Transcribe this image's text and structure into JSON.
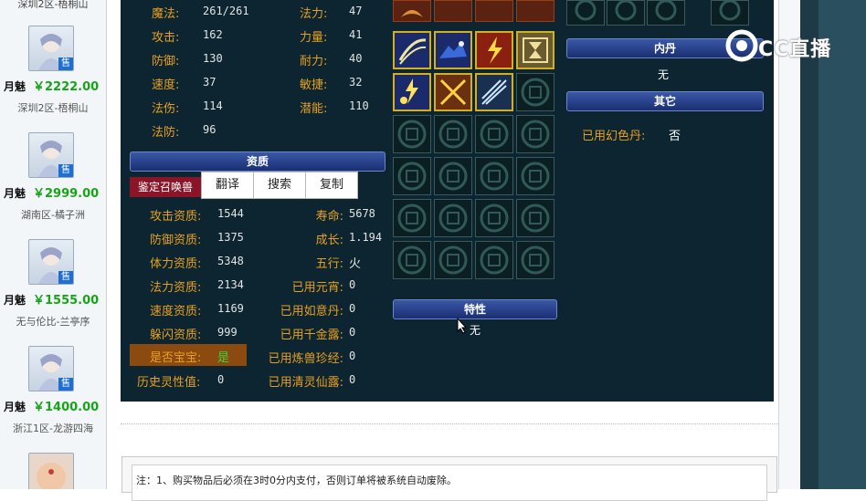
{
  "sidebar": {
    "top_server": "深圳2区-梧桐山",
    "items": [
      {
        "name": "月魅",
        "price": "￥2222.00",
        "server": "深圳2区-梧桐山",
        "badge": "售"
      },
      {
        "name": "月魅",
        "price": "￥2999.00",
        "server": "湖南区-橘子洲",
        "badge": "售"
      },
      {
        "name": "月魅",
        "price": "￥1555.00",
        "server": "无与伦比-兰亭序",
        "badge": "售"
      },
      {
        "name": "月魅",
        "price": "￥1400.00",
        "server": "浙江1区-龙游四海",
        "badge": "售"
      }
    ]
  },
  "stats_left": [
    {
      "label": "魔法:",
      "value": "261/261"
    },
    {
      "label": "攻击:",
      "value": "162"
    },
    {
      "label": "防御:",
      "value": "130"
    },
    {
      "label": "速度:",
      "value": "37"
    },
    {
      "label": "法伤:",
      "value": "114"
    },
    {
      "label": "法防:",
      "value": "96"
    }
  ],
  "stats_right": [
    {
      "label": "法力:",
      "value": "47"
    },
    {
      "label": "力量:",
      "value": "41"
    },
    {
      "label": "耐力:",
      "value": "40"
    },
    {
      "label": "敏捷:",
      "value": "32"
    },
    {
      "label": "潜能:",
      "value": "110"
    }
  ],
  "aptitude": {
    "title": "资质",
    "buttons": {
      "identify": "鉴定召唤兽",
      "translate": "翻译",
      "search": "搜索",
      "copy": "复制"
    },
    "left": [
      {
        "label": "攻击资质:",
        "value": "1544"
      },
      {
        "label": "防御资质:",
        "value": "1375"
      },
      {
        "label": "体力资质:",
        "value": "5348"
      },
      {
        "label": "法力资质:",
        "value": "2134"
      },
      {
        "label": "速度资质:",
        "value": "1169"
      },
      {
        "label": "躲闪资质:",
        "value": "999"
      },
      {
        "label": "是否宝宝:",
        "value": "是"
      },
      {
        "label": "历史灵性值:",
        "value": "0"
      }
    ],
    "right": [
      {
        "label": "寿命:",
        "value": "5678"
      },
      {
        "label": "成长:",
        "value": "1.194"
      },
      {
        "label": "五行:",
        "value": "火"
      },
      {
        "label": "已用元宵:",
        "value": "0"
      },
      {
        "label": "已用如意丹:",
        "value": "0"
      },
      {
        "label": "已用千金露:",
        "value": "0"
      },
      {
        "label": "已用炼兽珍经:",
        "value": "0"
      },
      {
        "label": "已用清灵仙露:",
        "value": "0"
      }
    ]
  },
  "traits": {
    "title": "特性",
    "value": "无"
  },
  "inner_dan": {
    "title": "内丹",
    "value": "无"
  },
  "other": {
    "title": "其它",
    "label": "已用幻色丹:",
    "value": "否"
  },
  "note": "注：1、购买物品后必须在3时0分内支付，否则订单将被系统自动废除。",
  "watermark": "CC直播",
  "colors": {
    "panel_bg": "#0c2530",
    "label": "#e8a020",
    "price": "#18a418",
    "bar": "#2a4590"
  }
}
